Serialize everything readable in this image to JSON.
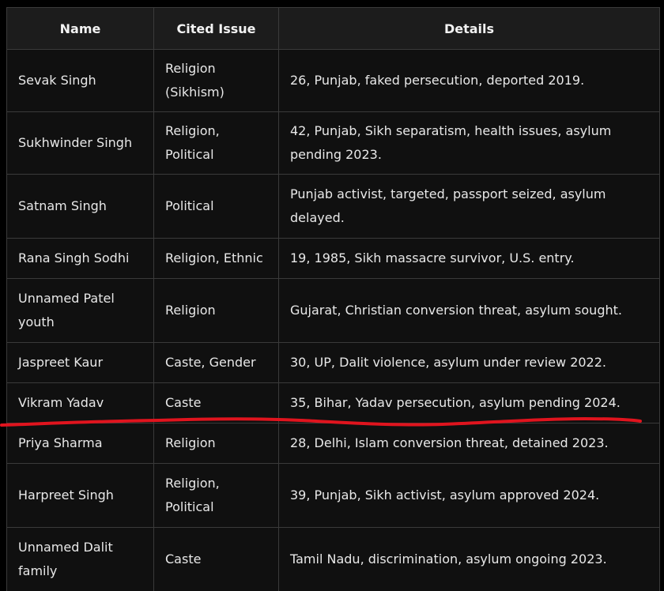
{
  "table": {
    "headers": [
      "Name",
      "Cited Issue",
      "Details"
    ],
    "rows": [
      {
        "name": "Sevak Singh",
        "issue": "Religion (Sikhism)",
        "details": "26, Punjab, faked persecution, deported 2019."
      },
      {
        "name": "Sukhwinder Singh",
        "issue": "Religion, Political",
        "details": "42, Punjab, Sikh separatism, health issues, asylum pending 2023."
      },
      {
        "name": "Satnam Singh",
        "issue": "Political",
        "details": "Punjab activist, targeted, passport seized, asylum delayed."
      },
      {
        "name": "Rana Singh Sodhi",
        "issue": "Religion, Ethnic",
        "details": "19, 1985, Sikh massacre survivor, U.S. entry."
      },
      {
        "name": "Unnamed Patel youth",
        "issue": "Religion",
        "details": "Gujarat, Christian conversion threat, asylum sought."
      },
      {
        "name": "Jaspreet Kaur",
        "issue": "Caste, Gender",
        "details": "30, UP, Dalit violence, asylum under review 2022."
      },
      {
        "name": "Vikram Yadav",
        "issue": "Caste",
        "details": "35, Bihar, Yadav persecution, asylum pending 2024."
      },
      {
        "name": "Priya Sharma",
        "issue": "Religion",
        "details": "28, Delhi, Islam conversion threat, detained 2023."
      },
      {
        "name": "Harpreet Singh",
        "issue": "Religion, Political",
        "details": "39, Punjab, Sikh activist, asylum approved 2024."
      },
      {
        "name": "Unnamed Dalit family",
        "issue": "Caste",
        "details": "Tamil Nadu, discrimination, asylum ongoing 2023."
      }
    ]
  },
  "annotation": {
    "type": "hand-drawn underline",
    "color": "#e0141e",
    "under_row": "Vikram Yadav"
  }
}
